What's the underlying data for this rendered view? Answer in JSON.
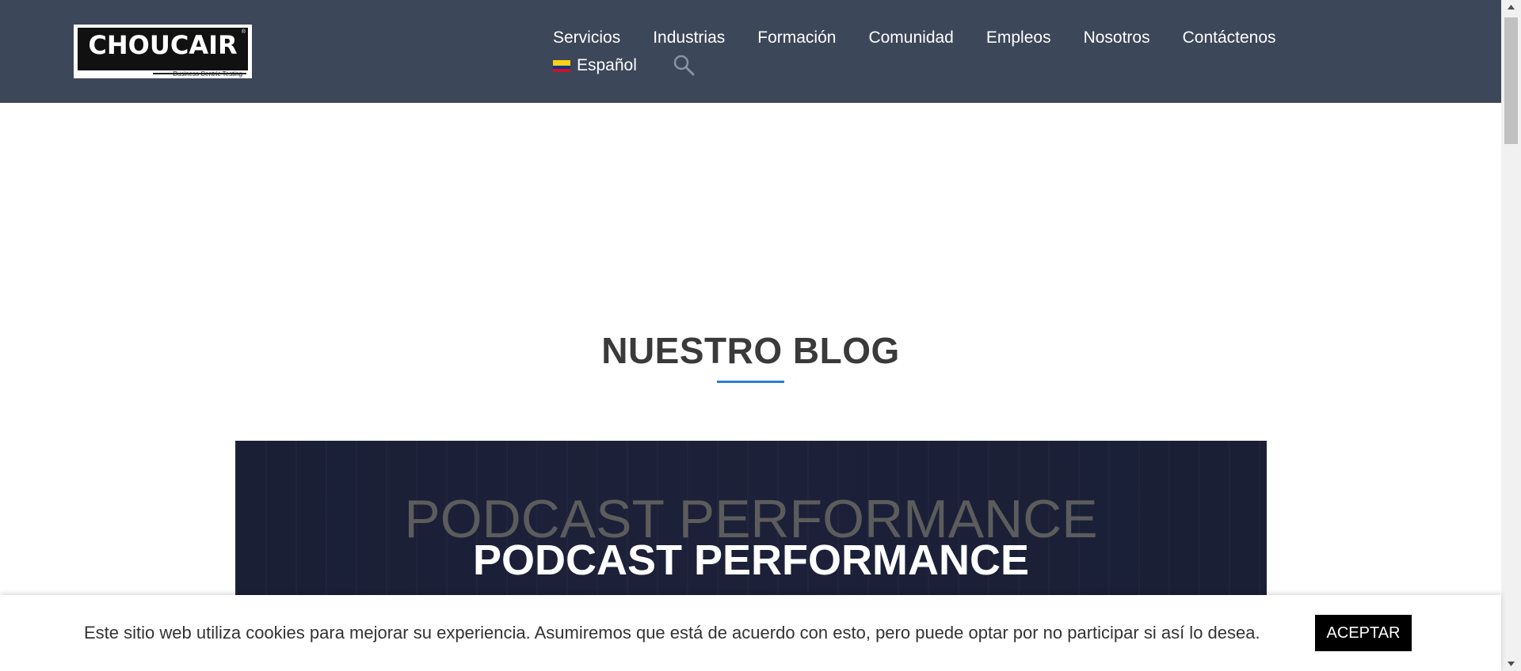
{
  "logo": {
    "text": "CHOUCAIR",
    "tagline": "Business Centric Testing",
    "registered": "®"
  },
  "nav": {
    "items": [
      "Servicios",
      "Industrias",
      "Formación",
      "Comunidad",
      "Empleos",
      "Nosotros",
      "Contáctenos"
    ],
    "language": "Español",
    "icons": {
      "search": "search-icon",
      "flag": "colombia-flag-icon"
    }
  },
  "section": {
    "title": "NUESTRO BLOG",
    "accent_color": "#2e7bd1"
  },
  "banner": {
    "ghost_text": "PODCAST PERFORMANCE",
    "title": "PODCAST PERFORMANCE"
  },
  "cookie": {
    "message": "Este sitio web utiliza cookies para mejorar su experiencia. Asumiremos que está de acuerdo con esto, pero puede optar por no participar si así lo desea.",
    "accept_label": "ACEPTAR"
  },
  "colors": {
    "header_bg": "#3c4759",
    "banner_bg": "#1a1f36"
  }
}
